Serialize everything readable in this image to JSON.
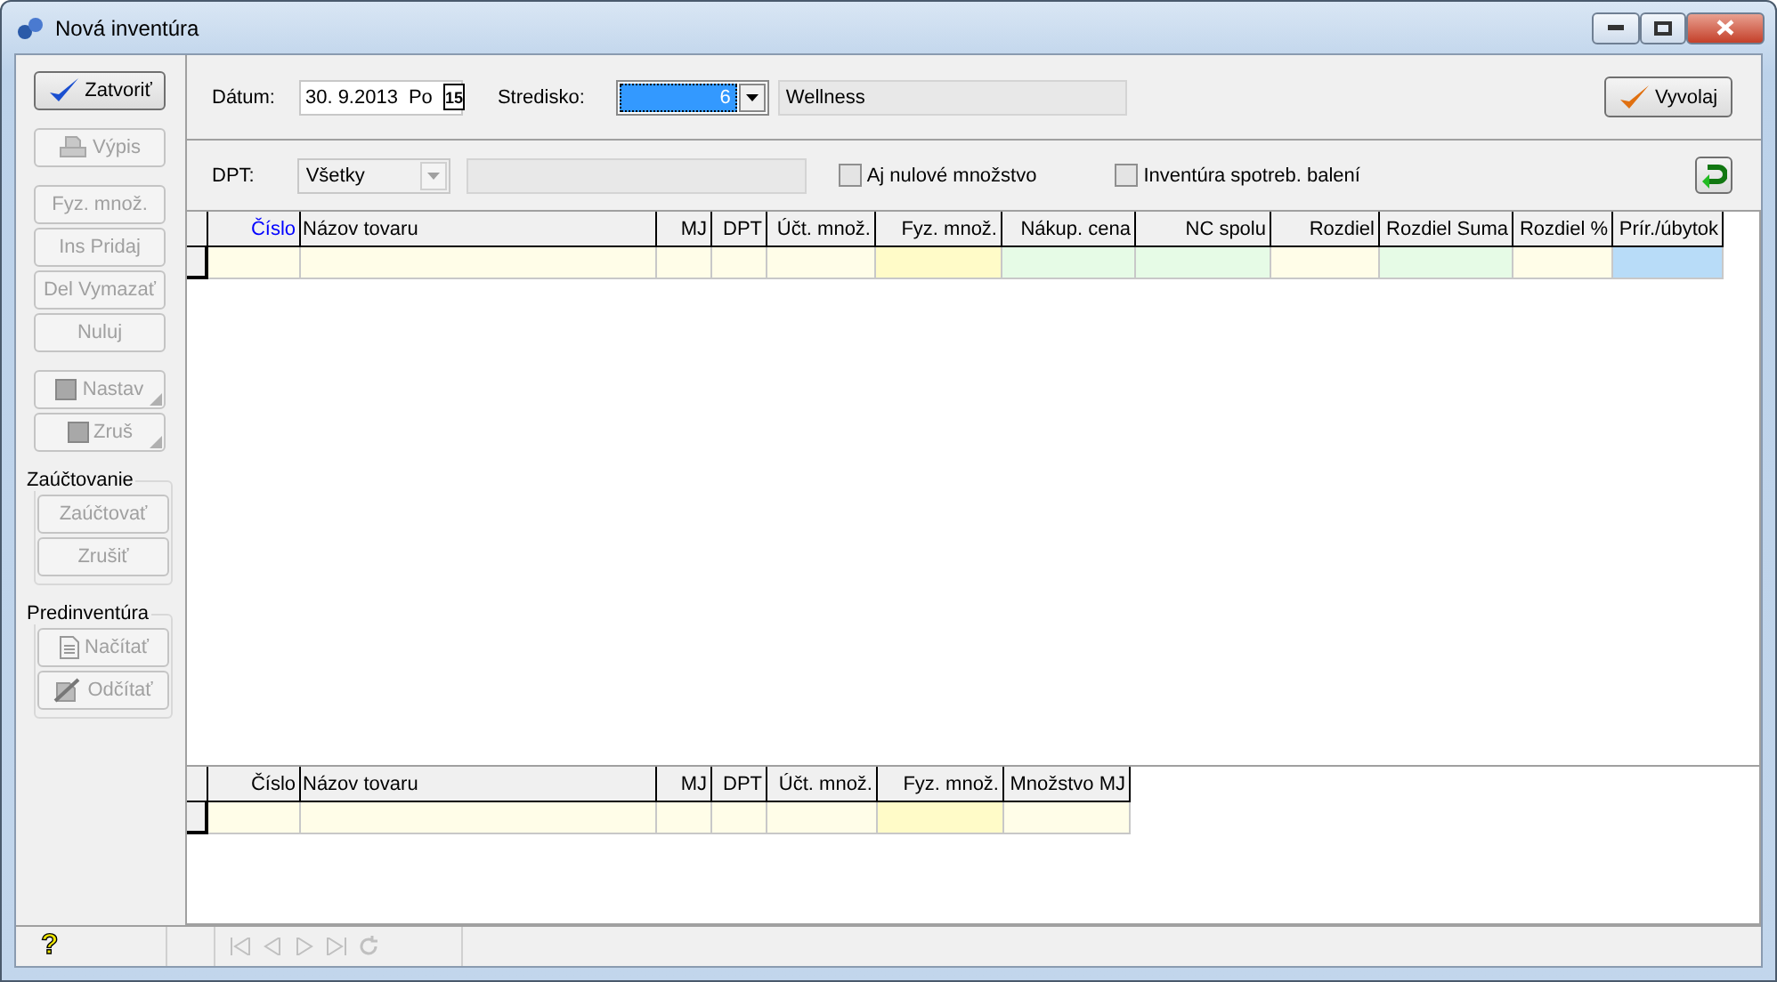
{
  "window": {
    "title": "Nová inventúra"
  },
  "sidebar": {
    "sections": [
      {
        "buttons": [
          {
            "label": "Zatvoriť",
            "kind": "check",
            "disabled": false,
            "menu": false
          }
        ]
      },
      {
        "buttons": [
          {
            "label": "Výpis",
            "kind": "print",
            "disabled": true,
            "menu": false
          }
        ]
      },
      {
        "buttons": [
          {
            "label": "Fyz. množ.",
            "kind": "plain",
            "disabled": true,
            "menu": false
          },
          {
            "label": "Ins Pridaj",
            "kind": "plain",
            "disabled": true,
            "menu": false
          },
          {
            "label": "Del Vymazať",
            "kind": "plain",
            "disabled": true,
            "menu": false
          },
          {
            "label": "Nuluj",
            "kind": "plain",
            "disabled": true,
            "menu": false
          }
        ]
      },
      {
        "buttons": [
          {
            "label": "Nastav",
            "kind": "square",
            "disabled": true,
            "menu": true
          },
          {
            "label": "Zruš",
            "kind": "square",
            "disabled": true,
            "menu": true
          }
        ]
      },
      {
        "title": "Zaúčtovanie",
        "buttons": [
          {
            "label": "Zaúčtovať",
            "kind": "plain",
            "disabled": true,
            "menu": false
          },
          {
            "label": "Zrušiť",
            "kind": "plain",
            "disabled": true,
            "menu": false
          }
        ]
      },
      {
        "title": "Predinventúra",
        "buttons": [
          {
            "label": "Načítať",
            "kind": "doc",
            "disabled": true,
            "menu": false
          },
          {
            "label": "Odčítať",
            "kind": "docedit",
            "disabled": true,
            "menu": false
          }
        ]
      }
    ]
  },
  "filters": {
    "date_label": "Dátum:",
    "date": "30. 9.2013",
    "weekday": "Po",
    "calendar": "15",
    "center_label": "Stredisko:",
    "center_code": "6",
    "center_name": "Wellness",
    "run_button": "Vyvolaj",
    "dpt_label": "DPT:",
    "dpt": "Všetky",
    "dpt_disabled": true,
    "checkboxes": [
      {
        "label": "Aj nulové množstvo",
        "checked": false
      },
      {
        "label": "Inventúra spotreb. balení",
        "checked": false
      }
    ]
  },
  "main_table": {
    "columns": [
      {
        "label": "Číslo",
        "kind": "number",
        "sorted": true,
        "color": "#fffde8"
      },
      {
        "label": "Názov tovaru",
        "kind": "text",
        "sorted": false,
        "color": "#fffde8"
      },
      {
        "label": "MJ",
        "kind": "number",
        "sorted": false,
        "color": "#fffde8"
      },
      {
        "label": "DPT",
        "kind": "number",
        "sorted": false,
        "color": "#fffde8"
      },
      {
        "label": "Účt. množ.",
        "kind": "number",
        "sorted": false,
        "color": "#fffde8"
      },
      {
        "label": "Fyz. množ.",
        "kind": "number",
        "sorted": false,
        "color": "#fffbc8"
      },
      {
        "label": "Nákup. cena",
        "kind": "number",
        "sorted": false,
        "color": "#e6fbe6"
      },
      {
        "label": "NC spolu",
        "kind": "number",
        "sorted": false,
        "color": "#e6fbe6"
      },
      {
        "label": "Rozdiel",
        "kind": "number",
        "sorted": false,
        "color": "#fffde8"
      },
      {
        "label": "Rozdiel Suma",
        "kind": "number",
        "sorted": false,
        "color": "#e6fbe6"
      },
      {
        "label": "Rozdiel %",
        "kind": "number",
        "sorted": false,
        "color": "#fffde8"
      },
      {
        "label": "Prír./úbytok",
        "kind": "number",
        "sorted": false,
        "color": "#b8dcf8"
      }
    ]
  },
  "lower_table": {
    "columns": [
      {
        "label": "Číslo",
        "kind": "number",
        "sorted": false,
        "color": "#fffde8"
      },
      {
        "label": "Názov tovaru",
        "kind": "text",
        "sorted": false,
        "color": "#fffde8"
      },
      {
        "label": "MJ",
        "kind": "number",
        "sorted": false,
        "color": "#fffde8"
      },
      {
        "label": "DPT",
        "kind": "number",
        "sorted": false,
        "color": "#fffde8"
      },
      {
        "label": "Účt. množ.",
        "kind": "number",
        "sorted": false,
        "color": "#fffde8"
      },
      {
        "label": "Fyz. množ.",
        "kind": "number",
        "sorted": false,
        "color": "#fffbc8"
      },
      {
        "label": "Množstvo MJ",
        "kind": "number",
        "sorted": false,
        "color": "#fffde8"
      }
    ]
  },
  "status_bar": {
    "help": "?"
  }
}
